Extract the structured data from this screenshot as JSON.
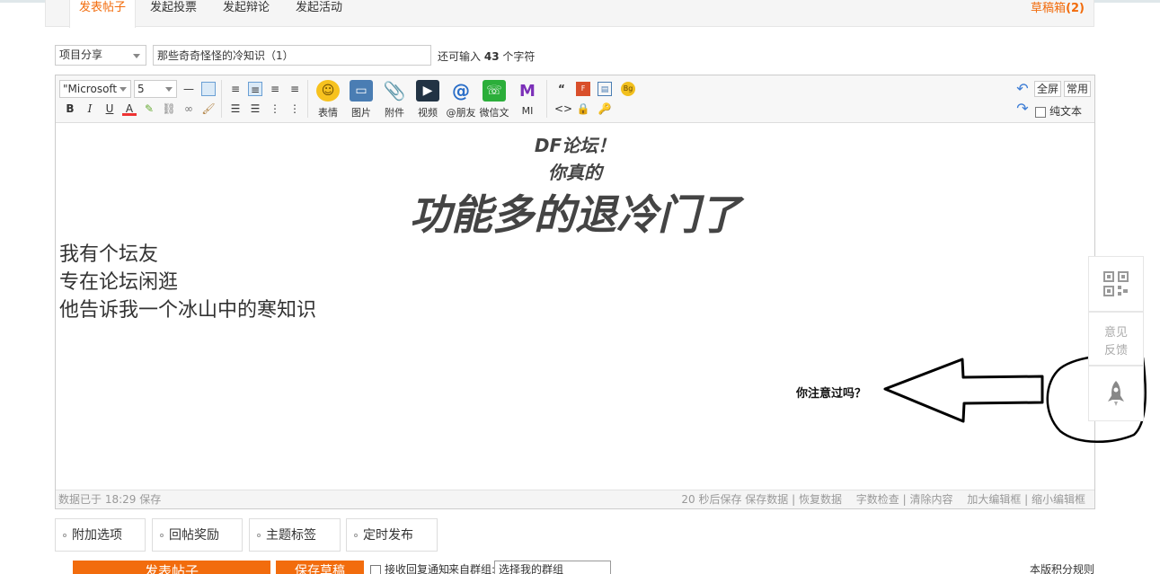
{
  "tabs": [
    {
      "label": "发表帖子",
      "active": true
    },
    {
      "label": "发起投票"
    },
    {
      "label": "发起辩论"
    },
    {
      "label": "发起活动"
    }
  ],
  "drafts": {
    "label": "草稿箱",
    "count": "(2)"
  },
  "subject": {
    "category": "项目分享",
    "title": "那些奇奇怪怪的冷知识（1）",
    "chars_prefix": "还可输入",
    "chars_count": "43",
    "chars_suffix": "个字符"
  },
  "toolbar": {
    "font_family": "\"Microsoft",
    "font_size": "5",
    "bold": "B",
    "italic": "I",
    "underline": "U",
    "big_buttons": [
      {
        "label": "表情",
        "icon": "emoji-icon"
      },
      {
        "label": "图片",
        "icon": "image-icon"
      },
      {
        "label": "附件",
        "icon": "attachment-icon"
      },
      {
        "label": "视频",
        "icon": "video-icon"
      },
      {
        "label": "@朋友",
        "icon": "at-icon"
      },
      {
        "label": "微信文",
        "icon": "wechat-icon"
      },
      {
        "label": "MI",
        "icon": "mi-icon"
      }
    ],
    "fullscreen": "全屏",
    "common": "常用",
    "plain_text": "纯文本"
  },
  "content": {
    "heading1": "DF论坛！",
    "heading2": "你真的",
    "heading3": "功能多的退冷门了",
    "lines": [
      "我有个坛友",
      "专在论坛闲逛",
      "他告诉我一个冰山中的寒知识"
    ],
    "notice": "你注意过吗？"
  },
  "statusbar": {
    "saved": "数据已于 18:29 保存",
    "autosave": "20 秒后保存 保存数据 | 恢复数据",
    "wordcheck": "字数检查 | 清除内容",
    "resize": "加大编辑框 | 缩小编辑框"
  },
  "options": [
    {
      "label": "附加选项"
    },
    {
      "label": "回帖奖励"
    },
    {
      "label": "主题标签"
    },
    {
      "label": "定时发布"
    }
  ],
  "bottom": {
    "submit": "发表帖子",
    "save_draft": "保存草稿",
    "subscribe": "接收回复通知",
    "group_label": "来自群组:",
    "group_select": "选择我的群组",
    "rules": "本版积分规则"
  },
  "side": {
    "feedback_line1": "意见",
    "feedback_line2": "反馈"
  },
  "colors": {
    "accent": "#f26c0d"
  }
}
